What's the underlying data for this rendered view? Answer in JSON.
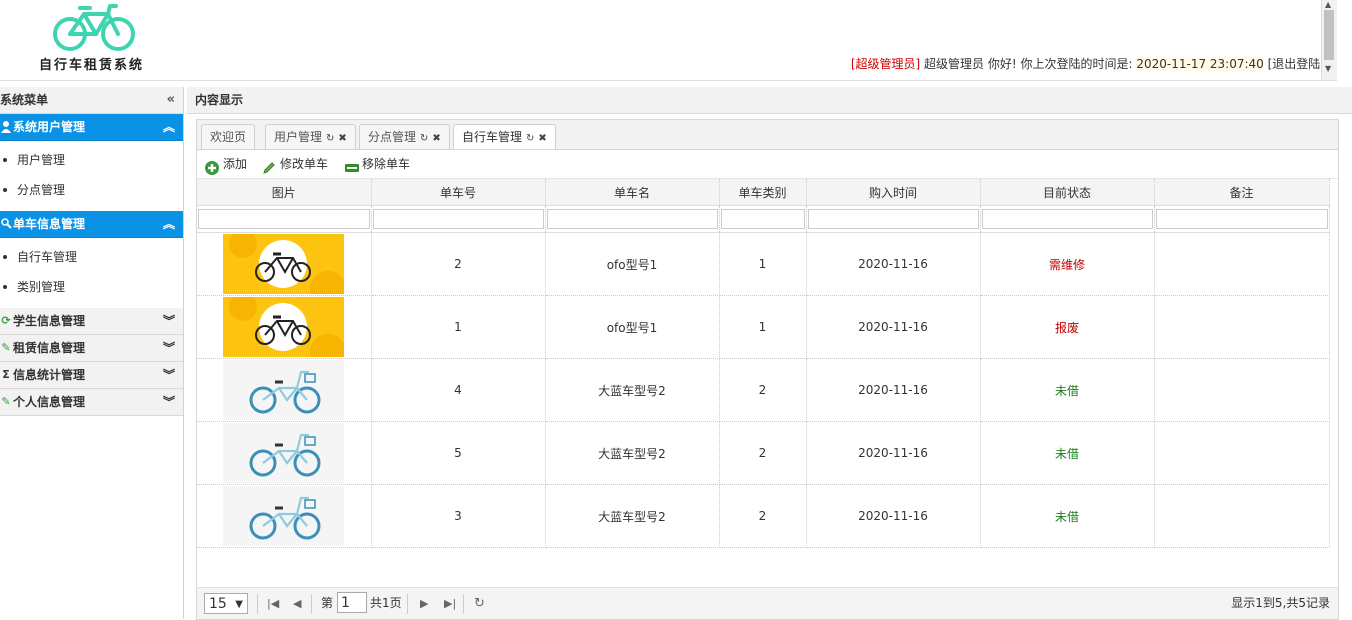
{
  "header": {
    "logo_text": "自行车租赁系统",
    "role": "[超级管理员]",
    "greeting": " 超级管理员 你好! 你上次登陆的时间是: ",
    "last_login": "2020-11-17 23:07:40",
    "logout": "[退出登陆]"
  },
  "sidebar": {
    "title": "系统菜单",
    "collapse_icon": "«",
    "groups": [
      {
        "label": "系统用户管理",
        "icon": "user-icon",
        "expanded": true,
        "items": [
          "用户管理",
          "分点管理"
        ]
      },
      {
        "label": "单车信息管理",
        "icon": "search-icon",
        "expanded": true,
        "items": [
          "自行车管理",
          "类别管理"
        ]
      },
      {
        "label": "学生信息管理",
        "icon": "refresh-icon",
        "expanded": false
      },
      {
        "label": "租赁信息管理",
        "icon": "pencil-icon",
        "expanded": false
      },
      {
        "label": "信息统计管理",
        "icon": "sigma-icon",
        "expanded": false
      },
      {
        "label": "个人信息管理",
        "icon": "pencil-icon",
        "expanded": false
      }
    ]
  },
  "content": {
    "title": "内容显示",
    "tabs": [
      "欢迎页",
      "用户管理",
      "分点管理",
      "自行车管理"
    ],
    "toolbar": {
      "add": "添加",
      "edit": "修改单车",
      "remove": "移除单车"
    },
    "columns": [
      "图片",
      "单车号",
      "单车名",
      "单车类别",
      "购入时间",
      "目前状态",
      "备注"
    ],
    "rows": [
      {
        "pic": "ofo",
        "id": "2",
        "name": "ofo型号1",
        "type": "1",
        "date": "2020-11-16",
        "status": "需维修",
        "status_color": "#c00000",
        "note": ""
      },
      {
        "pic": "ofo",
        "id": "1",
        "name": "ofo型号1",
        "type": "1",
        "date": "2020-11-16",
        "status": "报废",
        "status_color": "#c00000",
        "note": ""
      },
      {
        "pic": "blue",
        "id": "4",
        "name": "大蓝车型号2",
        "type": "2",
        "date": "2020-11-16",
        "status": "未借",
        "status_color": "#1a7f1a",
        "note": ""
      },
      {
        "pic": "blue",
        "id": "5",
        "name": "大蓝车型号2",
        "type": "2",
        "date": "2020-11-16",
        "status": "未借",
        "status_color": "#1a7f1a",
        "note": ""
      },
      {
        "pic": "blue",
        "id": "3",
        "name": "大蓝车型号2",
        "type": "2",
        "date": "2020-11-16",
        "status": "未借",
        "status_color": "#1a7f1a",
        "note": ""
      }
    ]
  },
  "pager": {
    "page_size": "15",
    "page_prefix": "第",
    "page_number": "1",
    "page_total": "共1页",
    "info": "显示1到5,共5记录"
  },
  "colors": {
    "accent": "#0a92e6",
    "logo": "#3fd4b0"
  }
}
